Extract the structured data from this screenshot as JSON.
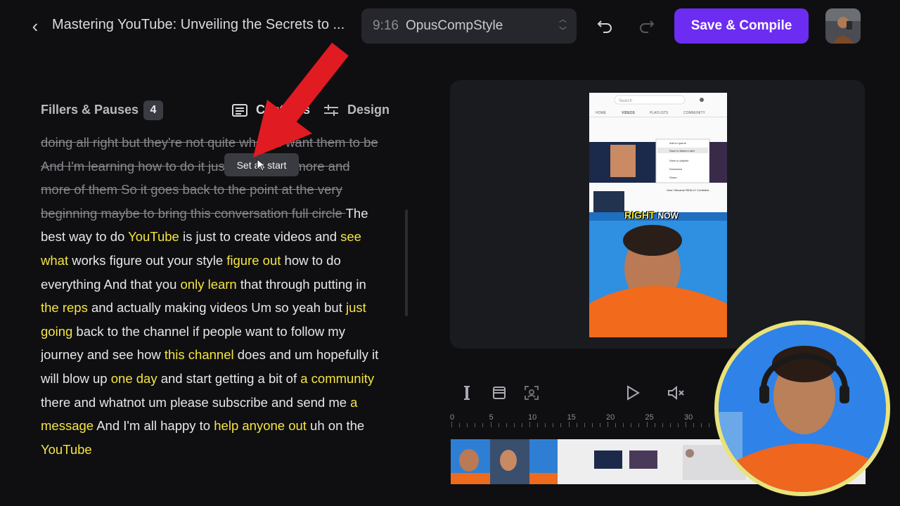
{
  "header": {
    "title": "Mastering YouTube: Unveiling the Secrets to ...",
    "aspect_ratio": "9:16",
    "style_name": "OpusCompStyle",
    "save_label": "Save & Compile"
  },
  "left_panel": {
    "fillers_label": "Fillers & Pauses",
    "fillers_count": "4",
    "tab_captions": "Captions",
    "tab_design": "Design",
    "tooltip": "Set as start"
  },
  "transcript": [
    {
      "t": "doing all right but they're not quite where I want them to be And I'm learning how to do it just by making more and more of them So it goes back to the point at the very beginning maybe to bring this conversation full circle ",
      "s": "struck"
    },
    {
      "t": "The best way to do ",
      "s": "norm"
    },
    {
      "t": "YouTube",
      "s": "hl"
    },
    {
      "t": " is just to create videos and ",
      "s": "norm"
    },
    {
      "t": "see what",
      "s": "hl"
    },
    {
      "t": " works figure out your style ",
      "s": "norm"
    },
    {
      "t": "figure out",
      "s": "hl"
    },
    {
      "t": " how to do everything And that you ",
      "s": "norm"
    },
    {
      "t": "only learn",
      "s": "hl"
    },
    {
      "t": " that through putting in ",
      "s": "norm"
    },
    {
      "t": "the reps",
      "s": "hl"
    },
    {
      "t": " and actually making videos Um so yeah but ",
      "s": "norm"
    },
    {
      "t": "just going",
      "s": "hl"
    },
    {
      "t": " back to the channel if people want to follow my journey and see how ",
      "s": "norm"
    },
    {
      "t": "this channel",
      "s": "hl"
    },
    {
      "t": " does and um hopefully it will blow up ",
      "s": "norm"
    },
    {
      "t": "one day",
      "s": "hl"
    },
    {
      "t": " and start getting a bit of ",
      "s": "norm"
    },
    {
      "t": "a community",
      "s": "hl"
    },
    {
      "t": " there and whatnot um please subscribe and send me ",
      "s": "norm"
    },
    {
      "t": "a message",
      "s": "hl"
    },
    {
      "t": " And I'm all happy to ",
      "s": "norm"
    },
    {
      "t": "help anyone out",
      "s": "hl"
    },
    {
      "t": " uh on the ",
      "s": "norm"
    },
    {
      "t": "YouTube",
      "s": "hl"
    }
  ],
  "preview": {
    "overlay_word_1": "RIGHT",
    "overlay_word_2": "NOW",
    "yt_search": "Search",
    "yt_tabs": [
      "HOME",
      "VIDEOS",
      "PLAYLISTS",
      "COMMUNITY"
    ],
    "yt_menu": [
      "Add to queue",
      "Save to Watch Later",
      "Save to playlist",
      "Download",
      "Share"
    ],
    "yt_video_title": "How I Became REALLY Confident"
  },
  "timeline": {
    "ticks": [
      "0",
      "5",
      "10",
      "15",
      "20",
      "25",
      "30"
    ]
  },
  "colors": {
    "accent": "#6c2cf2",
    "highlight": "#f4e443",
    "webcam_ring": "#e9e37a"
  }
}
